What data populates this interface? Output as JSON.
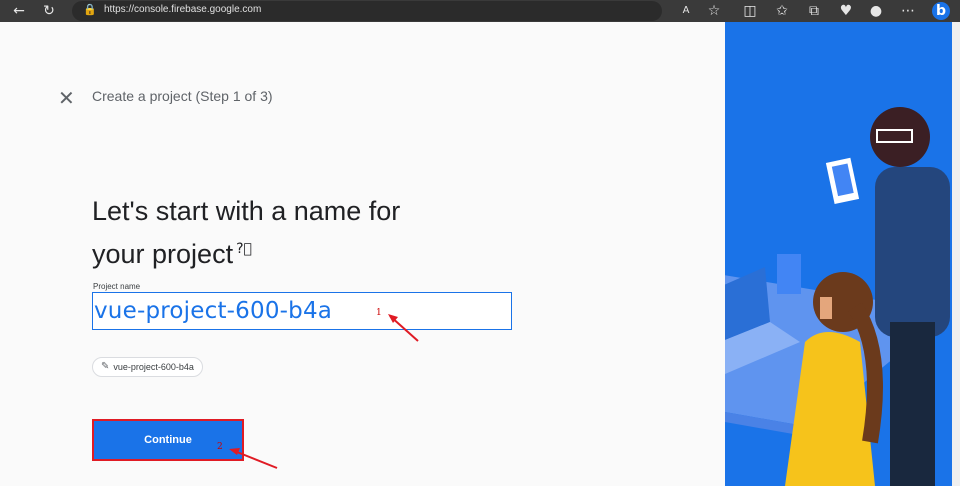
{
  "browser": {
    "url": "https://console.firebase.google.com",
    "icons": [
      "back-icon",
      "refresh-icon",
      "lock-icon",
      "read-aloud-icon",
      "favorite-star-icon",
      "split-screen-icon",
      "favorites-icon",
      "collections-icon",
      "health-icon",
      "profile-avatar-icon",
      "more-icon",
      "bing-icon"
    ]
  },
  "dialog": {
    "step_title": "Create a project (Step 1 of 3)",
    "heading_line1": "Let's start with a name for",
    "heading_line2": "your project",
    "field_label": "Project name",
    "field_value": "vue-project-600-b4a",
    "chip_label": "vue-project-600-b4a",
    "continue_label": "Continue"
  },
  "annotations": {
    "marker1": "1",
    "marker2": "2",
    "color": "#e01b24"
  },
  "colors": {
    "accent": "#1a73e8",
    "side_panel": "#1a73e8"
  }
}
